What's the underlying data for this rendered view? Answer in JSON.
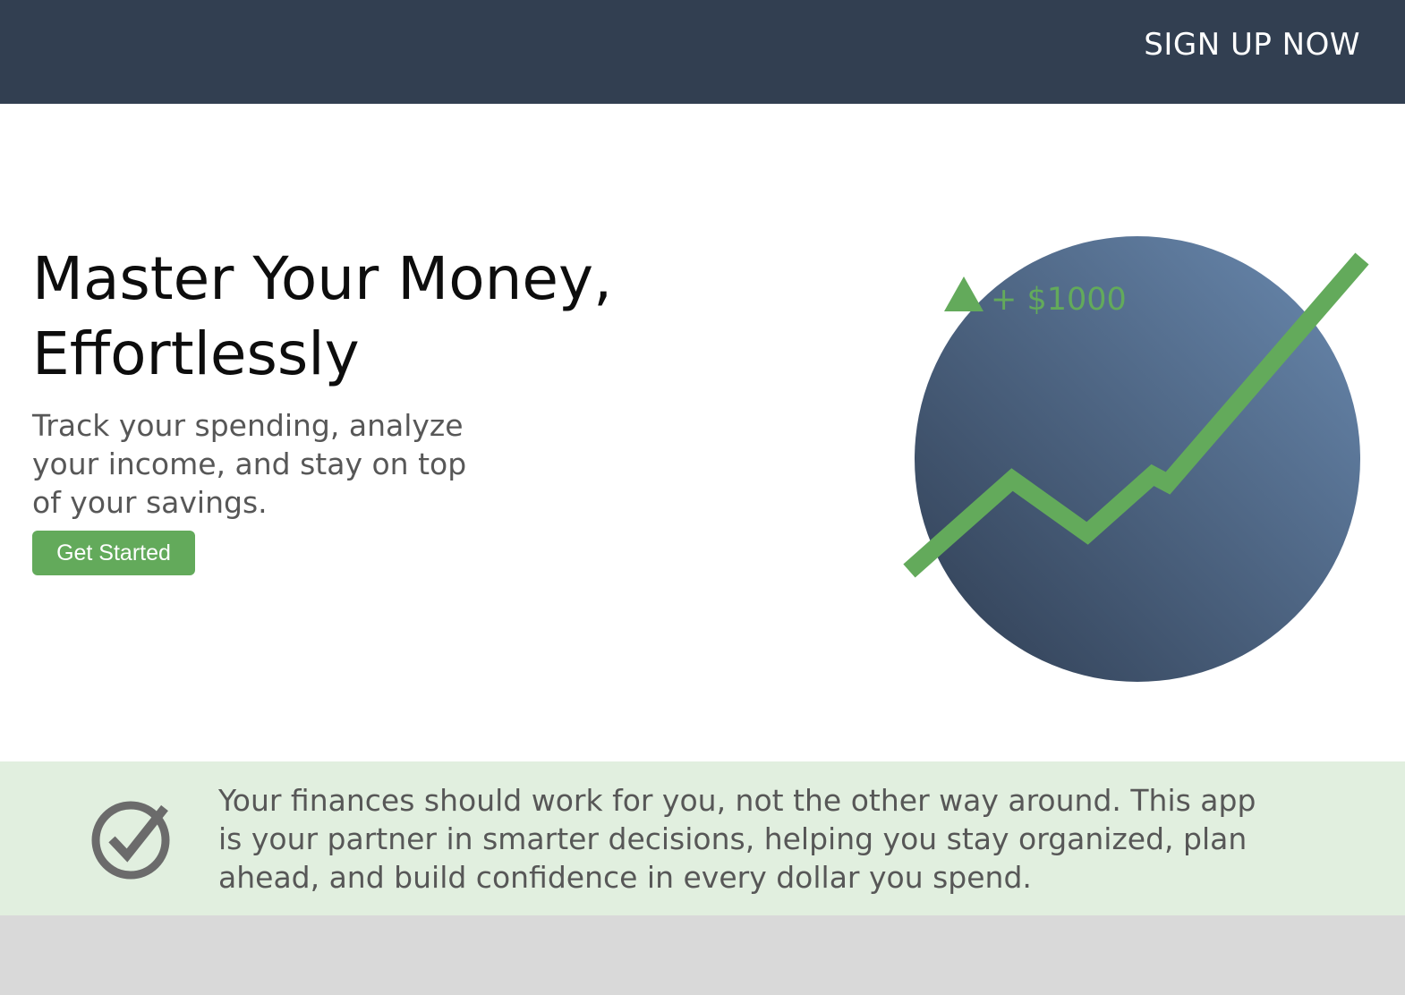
{
  "header": {
    "signup_label": "SIGN UP NOW",
    "background_color": "#323f51"
  },
  "hero": {
    "headline_line1": "Master Your Money,",
    "headline_line2": "Effortlessly",
    "subtitle": "Track your spending, analyze your income, and stay on top of your savings.",
    "cta_label": "Get Started",
    "illustration": {
      "gain_label": "+ $1000",
      "icons": [
        "up-triangle-icon",
        "trend-line-icon"
      ],
      "accent_color": "#63aa5b",
      "circle_gradient": [
        "#2f3d52",
        "#6a8ab0"
      ]
    }
  },
  "features": {
    "icon": "check-circle-icon",
    "text": "Your finances should work for you, not the other way around. This app is your partner in smarter decisions, helping you stay organized, plan ahead, and build confidence in every dollar you spend.",
    "background_color": "#e1efdf"
  }
}
